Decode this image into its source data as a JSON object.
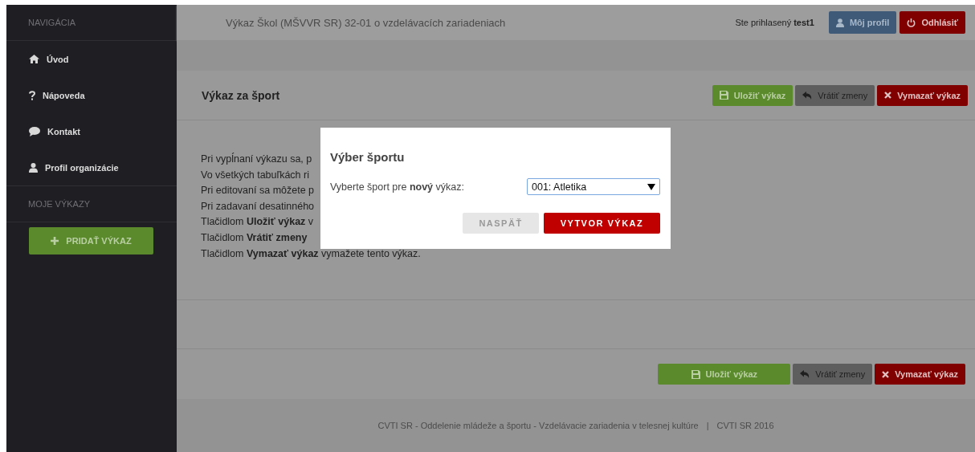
{
  "sidebar": {
    "sections": [
      {
        "heading": "NAVIGÁCIA",
        "items": [
          {
            "label": "Úvod"
          },
          {
            "label": "Nápoveda"
          },
          {
            "label": "Kontakt"
          },
          {
            "label": "Profil organizácie"
          }
        ]
      },
      {
        "heading": "MOJE VÝKAZY"
      }
    ],
    "add_button": "PRIDAŤ VÝKAZ"
  },
  "header": {
    "title": "Výkaz Škol (MŠVVR SR) 32-01 o vzdelávacích zariadeniach",
    "user": "Ste prihlasený **test1**",
    "buttons": [
      {
        "kind": "profile",
        "label": "Môj profil"
      },
      {
        "kind": "logout",
        "label": "Odhlásiť"
      }
    ]
  },
  "panel": {
    "title": "Výkaz za šport",
    "buttons": [
      {
        "kind": "save",
        "label": "Uložiť výkaz"
      },
      {
        "kind": "revert",
        "label": "Vrátiť zmeny"
      },
      {
        "kind": "delete",
        "label": "Vymazať výkaz"
      }
    ],
    "lines": [
      "Pri vypĺnaní výkazu sa, p",
      "Vo všetkých tabuľkách ri",
      "Pri editovaní sa môžete p",
      "Pri zadavaní desatinného",
      "Tlačidlom **Uložiť výkaz** v",
      "Tlačidlom **Vrátiť zmeny**",
      "Tlačidlom **Vymazať výkaz** vymažete tento výkaz."
    ],
    "footer_buttons": [
      {
        "kind": "save",
        "label": "Uložiť výkaz"
      },
      {
        "kind": "revert",
        "label": "Vrátiť zmeny"
      },
      {
        "kind": "delete",
        "label": "Vymazať výkaz"
      }
    ]
  },
  "footer": {
    "text": "CVTI SR - Oddelenie mládeže a športu - Vzdelávacie zariadenia v telesnej kultúre",
    "separator": "|",
    "copyright": "CVTI SR  2016"
  },
  "dialog": {
    "title": "Výber športu",
    "label": "Vyberte šport pre **nový** výkaz:",
    "select": {
      "value": "001: Atletika"
    },
    "buttons": [
      {
        "kind": "back",
        "label": "NASPÄŤ",
        "disabled": true
      },
      {
        "kind": "create",
        "label": "VYTVOR VÝKAZ",
        "disabled": false
      }
    ]
  }
}
